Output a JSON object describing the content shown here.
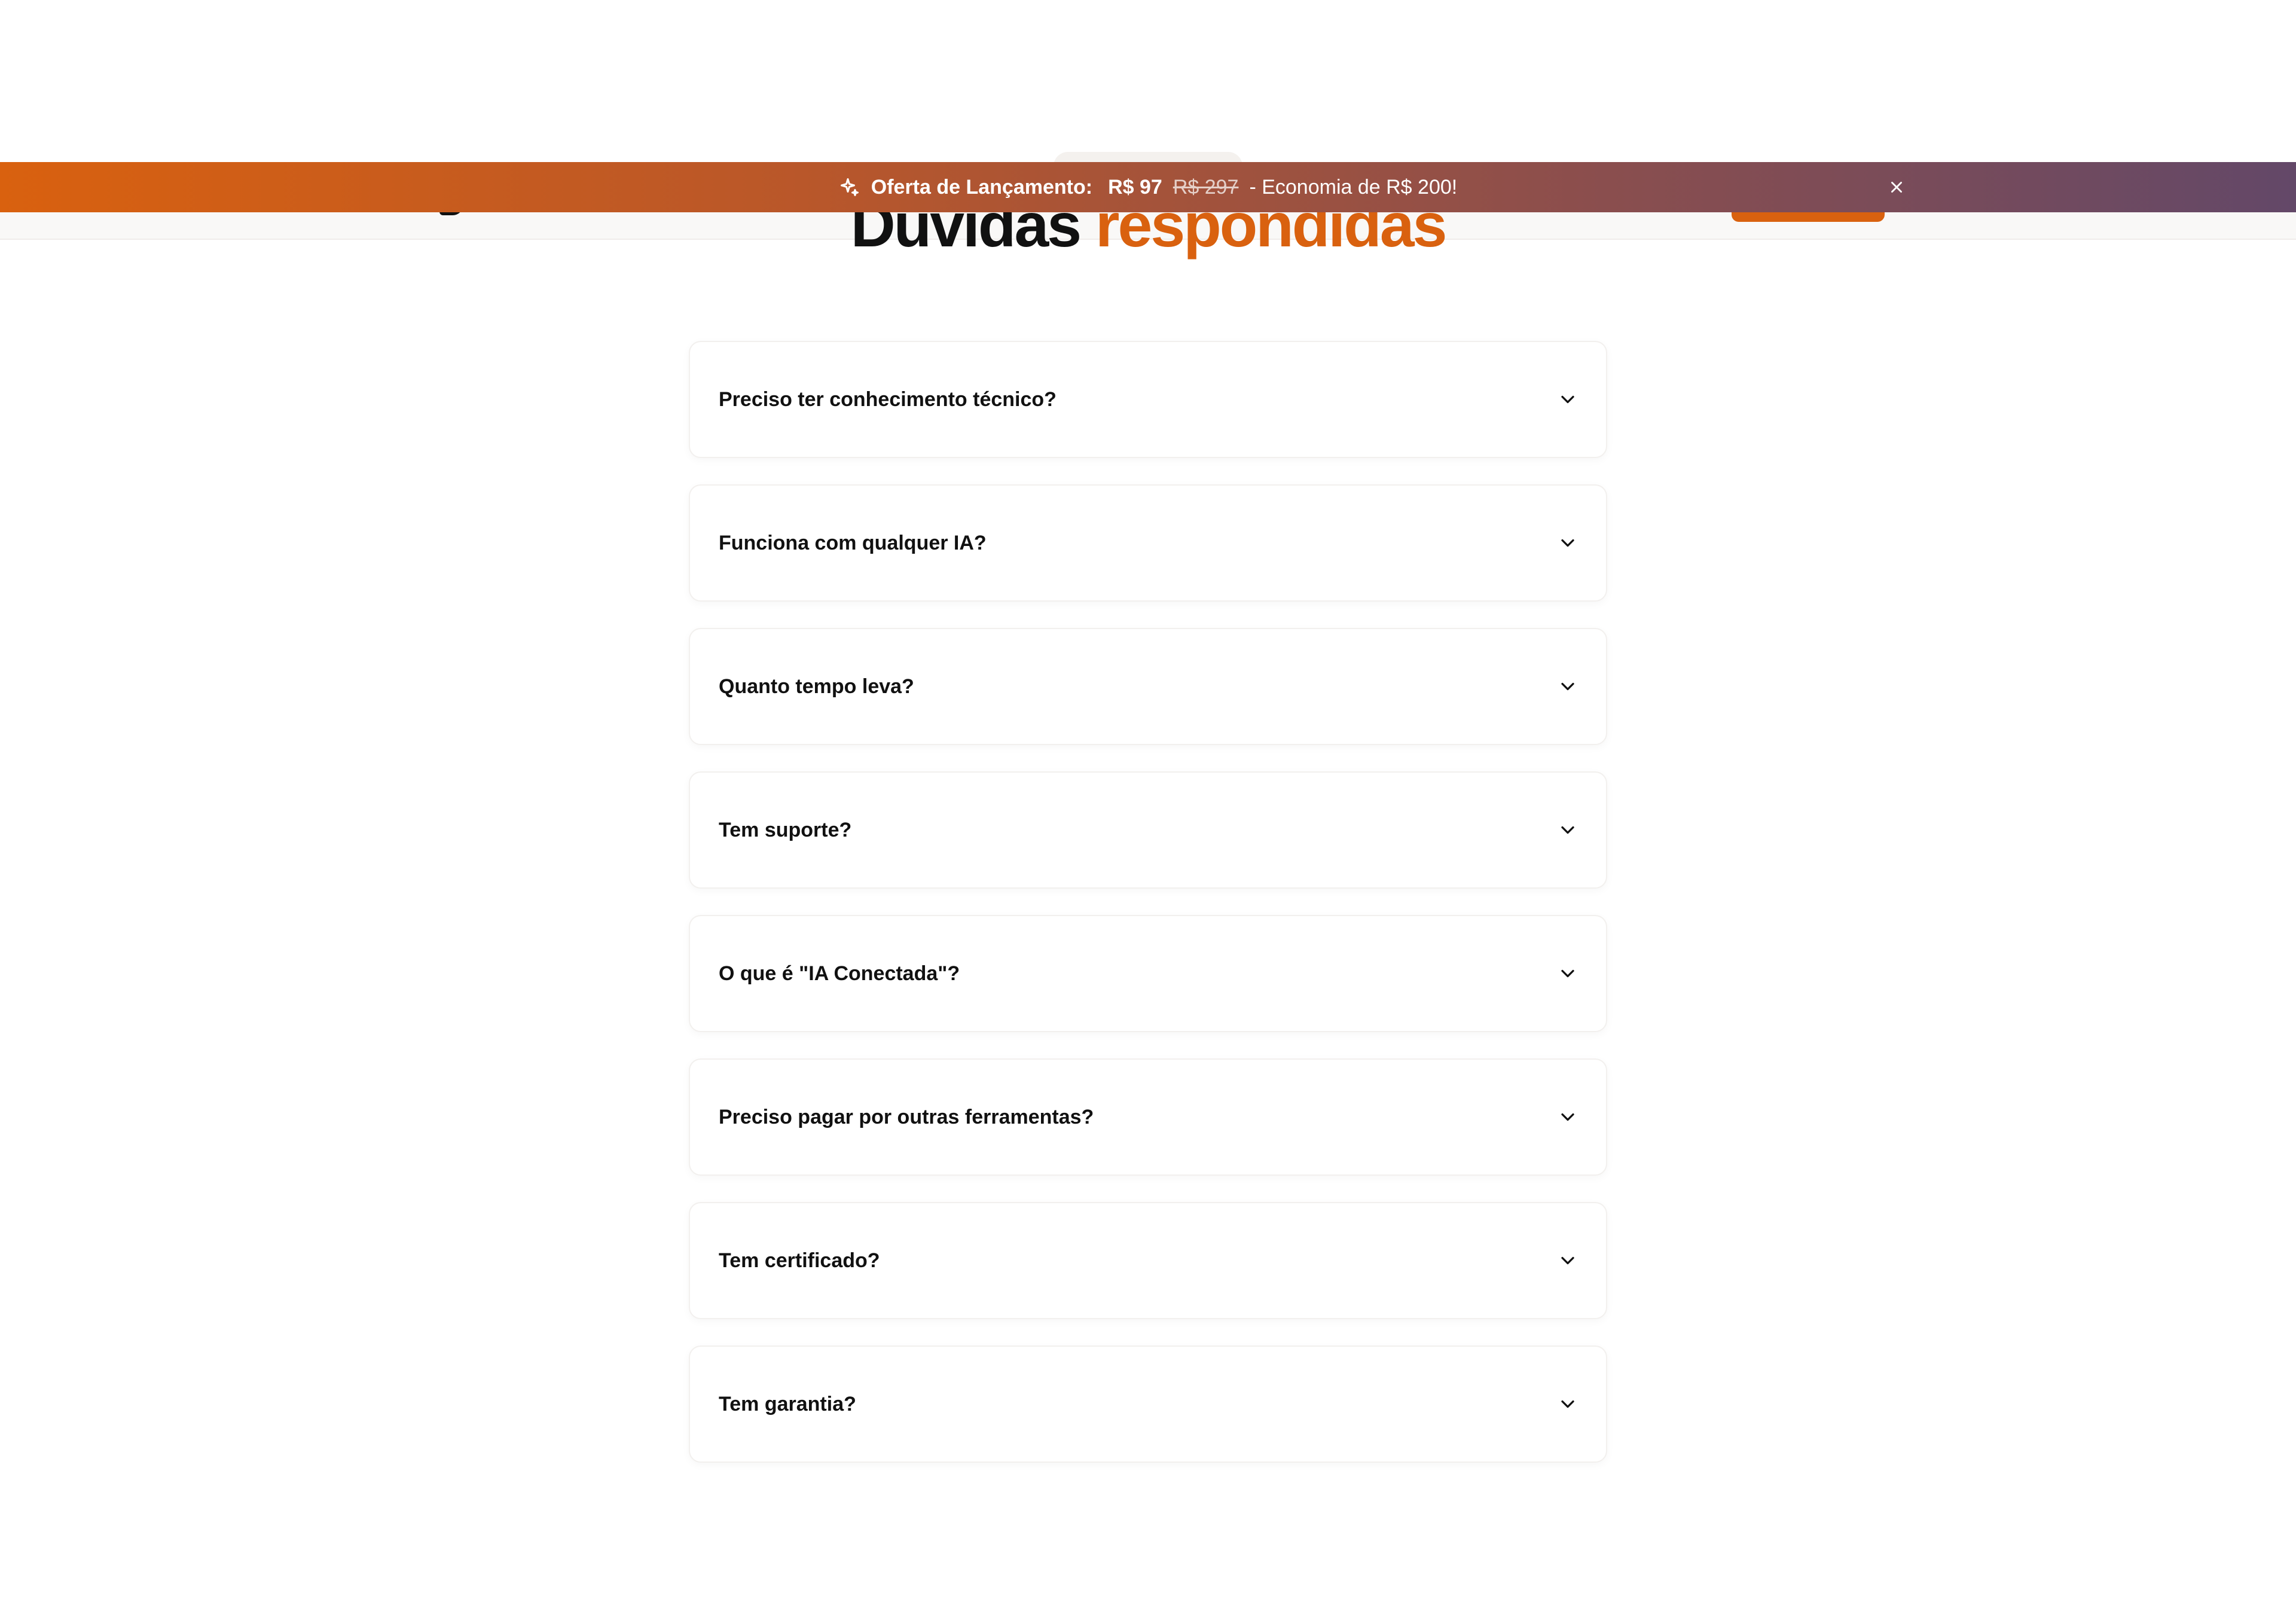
{
  "banner": {
    "offer_label": "Oferta de Lançamento:",
    "new_price": "R$ 97",
    "old_price": "R$ 297",
    "savings": "- Economia de R$ 200!",
    "icon": "sparkle-icon",
    "close_icon": "close-icon"
  },
  "section": {
    "title_dark": "Dúvidas",
    "title_accent": "respondidas"
  },
  "faq": {
    "items": [
      {
        "question": "Preciso ter conhecimento técnico?"
      },
      {
        "question": "Funciona com qualquer IA?"
      },
      {
        "question": "Quanto tempo leva?"
      },
      {
        "question": "Tem suporte?"
      },
      {
        "question": "O que é \"IA Conectada\"?"
      },
      {
        "question": "Preciso pagar por outras ferramentas?"
      },
      {
        "question": "Tem certificado?"
      },
      {
        "question": "Tem garantia?"
      }
    ]
  },
  "colors": {
    "accent": "#d9610f",
    "banner_gradient_start": "#d9610f",
    "banner_gradient_end": "#634868",
    "text": "#111111"
  }
}
